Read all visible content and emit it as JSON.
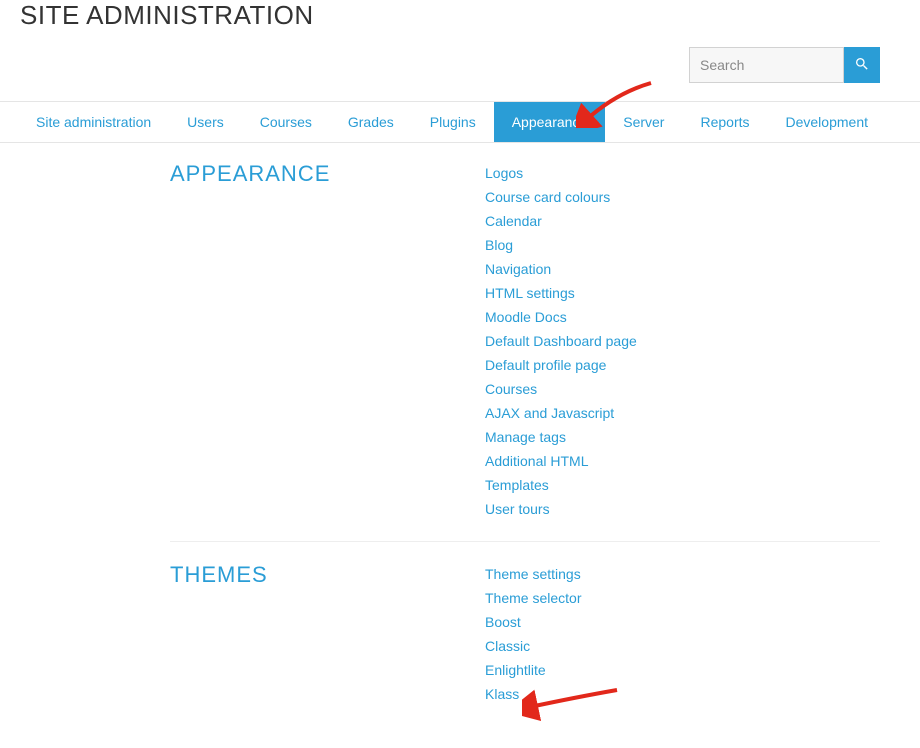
{
  "page_title": "SITE ADMINISTRATION",
  "search": {
    "placeholder": "Search",
    "value": ""
  },
  "tabs": [
    {
      "label": "Site administration",
      "active": false
    },
    {
      "label": "Users",
      "active": false
    },
    {
      "label": "Courses",
      "active": false
    },
    {
      "label": "Grades",
      "active": false
    },
    {
      "label": "Plugins",
      "active": false
    },
    {
      "label": "Appearance",
      "active": true
    },
    {
      "label": "Server",
      "active": false
    },
    {
      "label": "Reports",
      "active": false
    },
    {
      "label": "Development",
      "active": false
    }
  ],
  "sections": [
    {
      "heading": "APPEARANCE",
      "links": [
        "Logos",
        "Course card colours",
        "Calendar",
        "Blog",
        "Navigation",
        "HTML settings",
        "Moodle Docs",
        "Default Dashboard page",
        "Default profile page",
        "Courses",
        "AJAX and Javascript",
        "Manage tags",
        "Additional HTML",
        "Templates",
        "User tours"
      ]
    },
    {
      "heading": "THEMES",
      "links": [
        "Theme settings",
        "Theme selector",
        "Boost",
        "Classic",
        "Enlightlite",
        "Klass"
      ]
    }
  ],
  "colors": {
    "accent": "#2a9dd6",
    "arrow": "#e2281b"
  }
}
